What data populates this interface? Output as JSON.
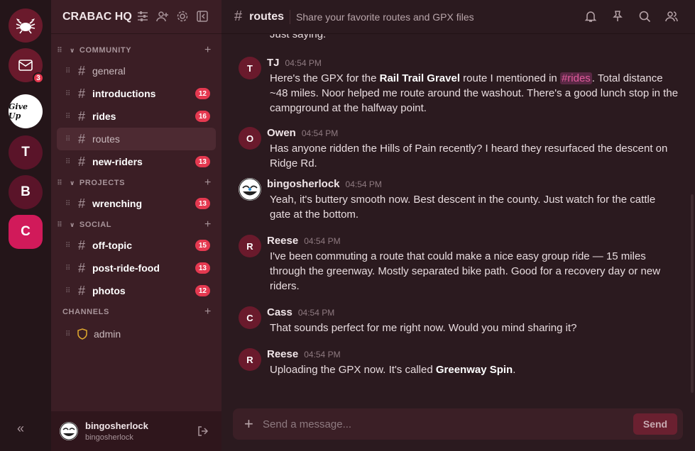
{
  "servers": {
    "mail_badge": "3",
    "give_up_logo_text": "Give Up",
    "letters": [
      "T",
      "B",
      "C"
    ]
  },
  "sidebar": {
    "title": "CRABAC HQ",
    "categories": [
      {
        "label": "COMMUNITY"
      },
      {
        "label": "PROJECTS"
      },
      {
        "label": "SOCIAL"
      },
      {
        "label": "CHANNELS"
      }
    ],
    "channels": [
      {
        "name": "general",
        "badge": ""
      },
      {
        "name": "introductions",
        "badge": "12"
      },
      {
        "name": "rides",
        "badge": "16"
      },
      {
        "name": "routes",
        "badge": ""
      },
      {
        "name": "new-riders",
        "badge": "13"
      },
      {
        "name": "wrenching",
        "badge": "13"
      },
      {
        "name": "off-topic",
        "badge": "15"
      },
      {
        "name": "post-ride-food",
        "badge": "13"
      },
      {
        "name": "photos",
        "badge": "12"
      },
      {
        "name": "admin",
        "badge": ""
      }
    ],
    "user": {
      "name": "bingosherlock",
      "sub": "bingosherlock"
    }
  },
  "main": {
    "channel": "routes",
    "topic": "Share your favorite routes and GPX files",
    "cut_text": "Just saying.",
    "messages": [
      {
        "author": "TJ",
        "initial": "T",
        "time": "04:54 PM",
        "parts": [
          "Here's the GPX for the ",
          "Rail Trail Gravel",
          " route I mentioned in ",
          "#rides",
          ". Total distance ~48 miles. Noor helped me route around the washout. There's a good lunch stop in the campground at the halfway point."
        ]
      },
      {
        "author": "Owen",
        "initial": "O",
        "time": "04:54 PM",
        "text": "Has anyone ridden the Hills of Pain recently? I heard they resurfaced the descent on Ridge Rd."
      },
      {
        "author": "bingosherlock",
        "initial": "",
        "time": "04:54 PM",
        "text": "Yeah, it's buttery smooth now. Best descent in the county. Just watch for the cattle gate at the bottom."
      },
      {
        "author": "Reese",
        "initial": "R",
        "time": "04:54 PM",
        "text": "I've been commuting a route that could make a nice easy group ride — 15 miles through the greenway. Mostly separated bike path. Good for a recovery day or new riders."
      },
      {
        "author": "Cass",
        "initial": "C",
        "time": "04:54 PM",
        "text": "That sounds perfect for me right now. Would you mind sharing it?"
      },
      {
        "author": "Reese",
        "initial": "R",
        "time": "04:54 PM",
        "parts": [
          "Uploading the GPX now. It's called ",
          "Greenway Spin",
          "."
        ]
      }
    ],
    "composer": {
      "placeholder": "Send a message...",
      "send_label": "Send"
    }
  },
  "colors": {
    "accent": "#d11a5a",
    "badge": "#e53950",
    "mention": "#e05a9c"
  }
}
